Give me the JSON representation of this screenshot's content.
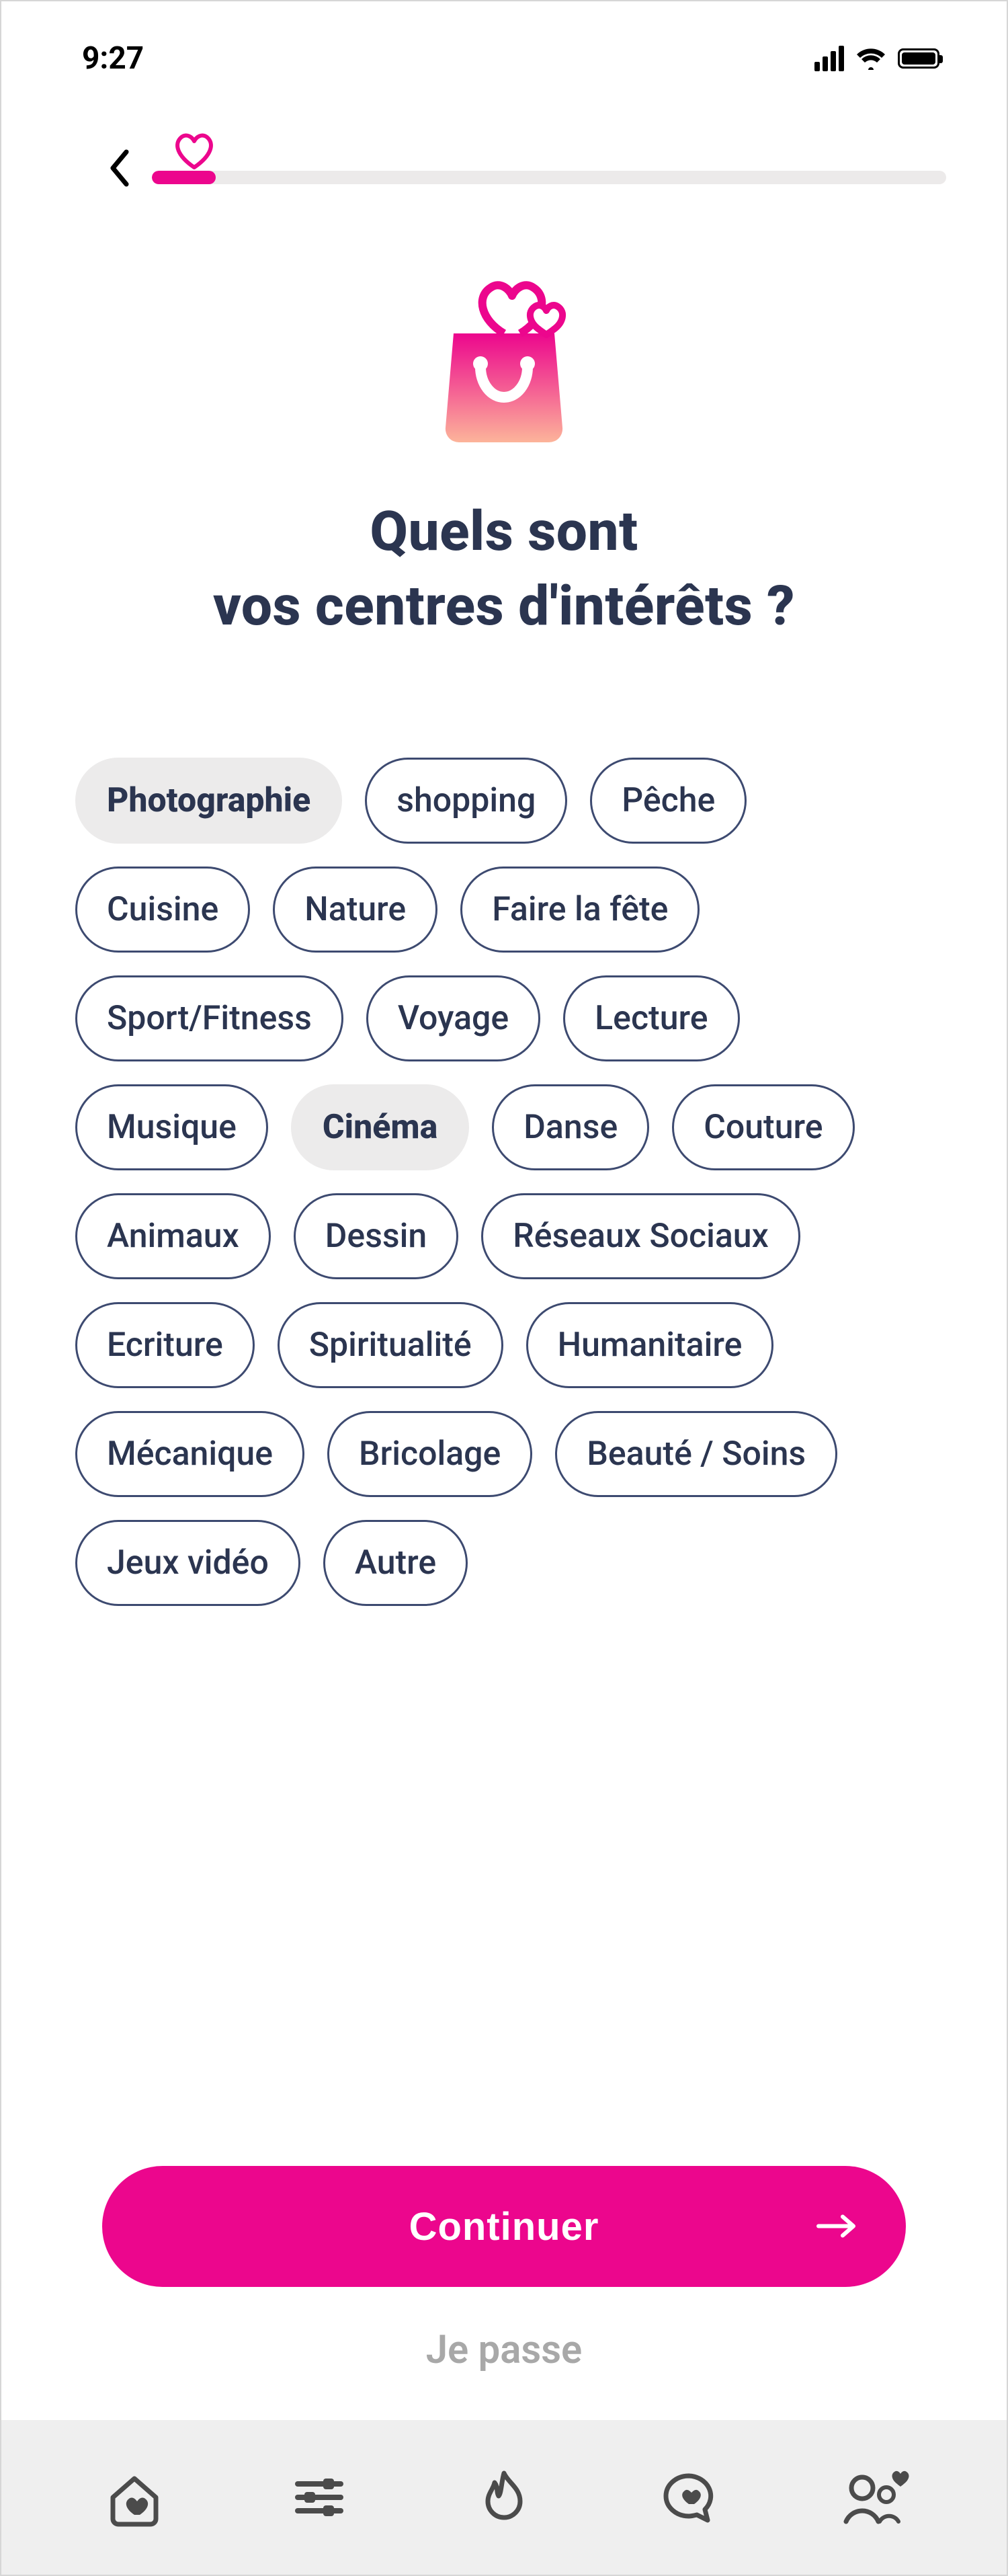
{
  "status": {
    "time": "9:27"
  },
  "progress": {
    "percent": 8
  },
  "title_line1": "Quels sont",
  "title_line2": "vos centres d'intérêts ?",
  "interests": [
    {
      "label": "Photographie",
      "selected": true
    },
    {
      "label": "shopping",
      "selected": false
    },
    {
      "label": "Pêche",
      "selected": false
    },
    {
      "label": "Cuisine",
      "selected": false
    },
    {
      "label": "Nature",
      "selected": false
    },
    {
      "label": "Faire la fête",
      "selected": false
    },
    {
      "label": "Sport/Fitness",
      "selected": false
    },
    {
      "label": "Voyage",
      "selected": false
    },
    {
      "label": "Lecture",
      "selected": false
    },
    {
      "label": "Musique",
      "selected": false
    },
    {
      "label": "Cinéma",
      "selected": true
    },
    {
      "label": "Danse",
      "selected": false
    },
    {
      "label": "Couture",
      "selected": false
    },
    {
      "label": "Animaux",
      "selected": false
    },
    {
      "label": "Dessin",
      "selected": false
    },
    {
      "label": "Réseaux Sociaux",
      "selected": false
    },
    {
      "label": "Ecriture",
      "selected": false
    },
    {
      "label": "Spiritualité",
      "selected": false
    },
    {
      "label": "Humanitaire",
      "selected": false
    },
    {
      "label": "Mécanique",
      "selected": false
    },
    {
      "label": "Bricolage",
      "selected": false
    },
    {
      "label": "Beauté / Soins",
      "selected": false
    },
    {
      "label": "Jeux vidéo",
      "selected": false
    },
    {
      "label": "Autre",
      "selected": false
    }
  ],
  "actions": {
    "continue": "Continuer",
    "skip": "Je passe"
  },
  "colors": {
    "accent": "#ec068d",
    "text": "#2b3550",
    "chipBorder": "#3d4a70",
    "chipSelectedBg": "#ecebeb",
    "tabbarBg": "#efefef",
    "muted": "#a8a8a8"
  },
  "tabs": [
    {
      "name": "home"
    },
    {
      "name": "filters"
    },
    {
      "name": "discover"
    },
    {
      "name": "messages"
    },
    {
      "name": "profile"
    }
  ]
}
